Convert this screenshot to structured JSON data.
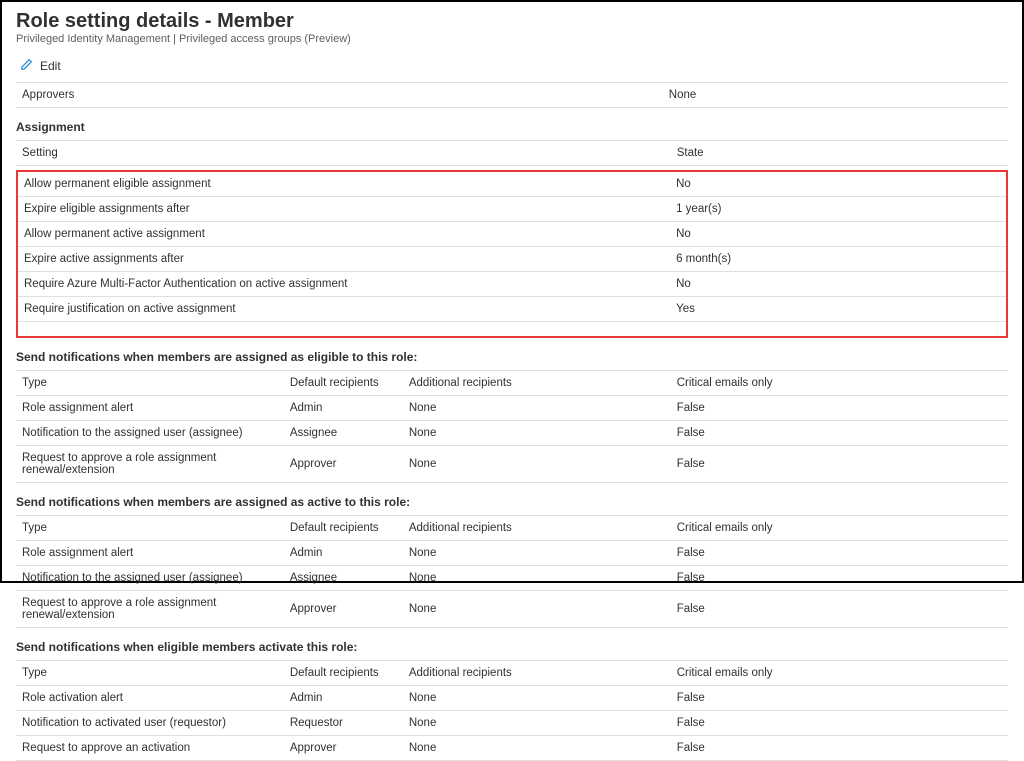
{
  "header": {
    "title": "Role setting details - Member",
    "breadcrumb": "Privileged Identity Management | Privileged access groups (Preview)",
    "editLabel": "Edit"
  },
  "approvers": {
    "label": "Approvers",
    "value": "None"
  },
  "assignment": {
    "sectionTitle": "Assignment",
    "col1": "Setting",
    "col2": "State",
    "rows": [
      {
        "setting": "Allow permanent eligible assignment",
        "state": "No"
      },
      {
        "setting": "Expire eligible assignments after",
        "state": "1 year(s)"
      },
      {
        "setting": "Allow permanent active assignment",
        "state": "No"
      },
      {
        "setting": "Expire active assignments after",
        "state": "6 month(s)"
      },
      {
        "setting": "Require Azure Multi-Factor Authentication on active assignment",
        "state": "No"
      },
      {
        "setting": "Require justification on active assignment",
        "state": "Yes"
      }
    ]
  },
  "notifEligible": {
    "title": "Send notifications when members are assigned as eligible to this role:",
    "cols": {
      "c1": "Type",
      "c2": "Default recipients",
      "c3": "Additional recipients",
      "c4": "Critical emails only"
    },
    "rows": [
      {
        "c1": "Role assignment alert",
        "c2": "Admin",
        "c3": "None",
        "c4": "False"
      },
      {
        "c1": "Notification to the assigned user (assignee)",
        "c2": "Assignee",
        "c3": "None",
        "c4": "False"
      },
      {
        "c1": "Request to approve a role assignment renewal/extension",
        "c2": "Approver",
        "c3": "None",
        "c4": "False"
      }
    ]
  },
  "notifActive": {
    "title": "Send notifications when members are assigned as active to this role:",
    "cols": {
      "c1": "Type",
      "c2": "Default recipients",
      "c3": "Additional recipients",
      "c4": "Critical emails only"
    },
    "rows": [
      {
        "c1": "Role assignment alert",
        "c2": "Admin",
        "c3": "None",
        "c4": "False"
      },
      {
        "c1": "Notification to the assigned user (assignee)",
        "c2": "Assignee",
        "c3": "None",
        "c4": "False"
      },
      {
        "c1": "Request to approve a role assignment renewal/extension",
        "c2": "Approver",
        "c3": "None",
        "c4": "False"
      }
    ]
  },
  "notifActivate": {
    "title": "Send notifications when eligible members activate this role:",
    "cols": {
      "c1": "Type",
      "c2": "Default recipients",
      "c3": "Additional recipients",
      "c4": "Critical emails only"
    },
    "rows": [
      {
        "c1": "Role activation alert",
        "c2": "Admin",
        "c3": "None",
        "c4": "False"
      },
      {
        "c1": "Notification to activated user (requestor)",
        "c2": "Requestor",
        "c3": "None",
        "c4": "False"
      },
      {
        "c1": "Request to approve an activation",
        "c2": "Approver",
        "c3": "None",
        "c4": "False"
      }
    ]
  }
}
